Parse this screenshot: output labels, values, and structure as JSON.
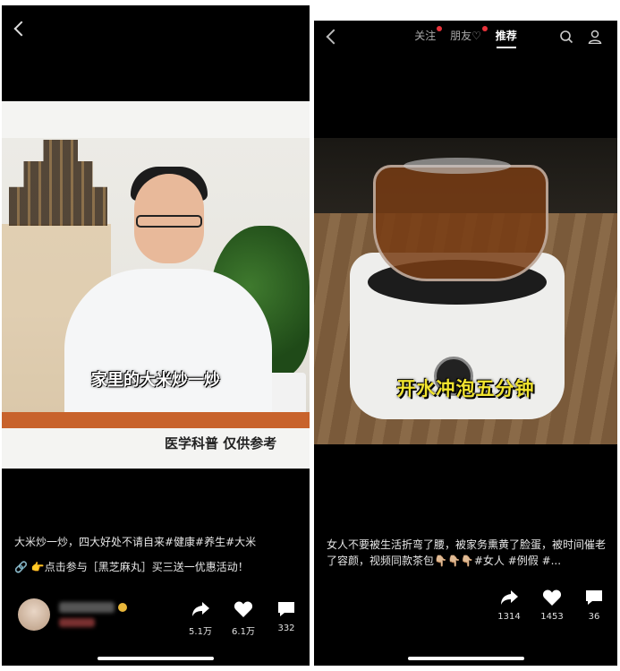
{
  "left": {
    "video": {
      "caption": "家里的大米炒一炒",
      "watermark": "医学科普 仅供参考"
    },
    "description": "大米炒一炒，四大好处不请自来#健康#养生#大米",
    "promo": "👉点击参与［黑芝麻丸］买三送一优惠活动！",
    "actions": {
      "share_count": "5.1万",
      "like_count": "6.1万",
      "comment_count": "332"
    }
  },
  "right": {
    "tabs": [
      {
        "label": "关注"
      },
      {
        "label": "朋友♡"
      },
      {
        "label": "推荐"
      }
    ],
    "video": {
      "caption": "开水冲泡五分钟"
    },
    "description": "女人不要被生活折弯了腰，被家务熏黄了脸蛋，被时间催老了容颜，视频同款茶包👇🏼👇🏼👇🏼#女人 #例假 #...",
    "actions": {
      "share_count": "1314",
      "like_count": "1453",
      "comment_count": "36"
    }
  },
  "colors": {
    "background": "#000000",
    "accent_red": "#e8323a",
    "caption_yellow": "#f0e330"
  }
}
